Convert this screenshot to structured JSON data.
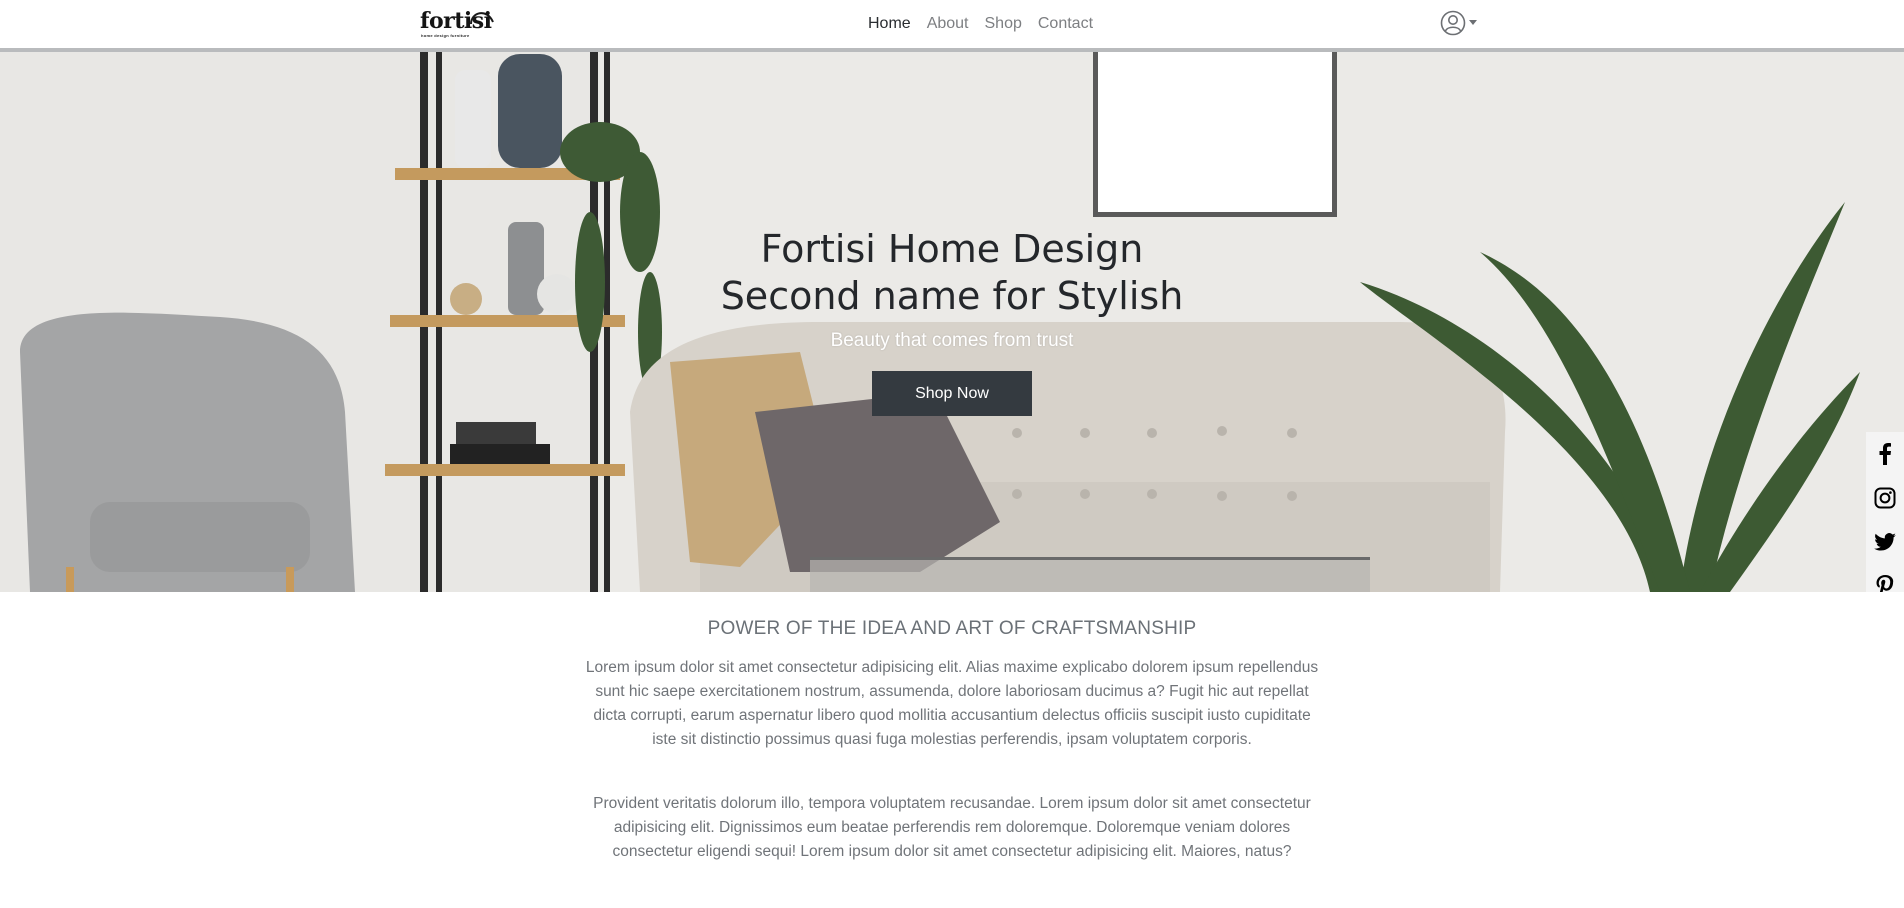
{
  "brand": {
    "logo_text": "fortisi",
    "logo_tagline": "home design furniture"
  },
  "nav": {
    "links": [
      {
        "label": "Home",
        "active": true
      },
      {
        "label": "About",
        "active": false
      },
      {
        "label": "Shop",
        "active": false
      },
      {
        "label": "Contact",
        "active": false
      }
    ],
    "user_icon": "user-circle-icon"
  },
  "hero": {
    "title_line1": "Fortisi Home Design",
    "title_line2": "Second name for Stylish",
    "subtitle": "Beauty that comes from trust",
    "cta_label": "Shop Now"
  },
  "social": {
    "icons": [
      "facebook-icon",
      "instagram-icon",
      "twitter-icon",
      "pinterest-icon"
    ]
  },
  "about": {
    "heading": "POWER OF THE IDEA AND ART OF CRAFTSMANSHIP",
    "paragraph1": "Lorem ipsum dolor sit amet consectetur adipisicing elit. Alias maxime explicabo dolorem ipsum repellendus sunt hic saepe exercitationem nostrum, assumenda, dolore laboriosam ducimus a? Fugit hic aut repellat dicta corrupti, earum aspernatur libero quod mollitia accusantium delectus officiis suscipit iusto cupiditate iste sit distinctio possimus quasi fuga molestias perferendis, ipsam voluptatem corporis.",
    "paragraph2": "Provident veritatis dolorum illo, tempora voluptatem recusandae. Lorem ipsum dolor sit amet consectetur adipisicing elit. Dignissimos eum beatae perferendis rem doloremque. Doloremque veniam dolores consectetur eligendi sequi! Lorem ipsum dolor sit amet consectetur adipisicing elit. Maiores, natus?"
  },
  "colors": {
    "button_bg": "#343a40",
    "text_muted": "#707479",
    "heading": "#24272b",
    "nav_border": "#b9bbbd"
  }
}
